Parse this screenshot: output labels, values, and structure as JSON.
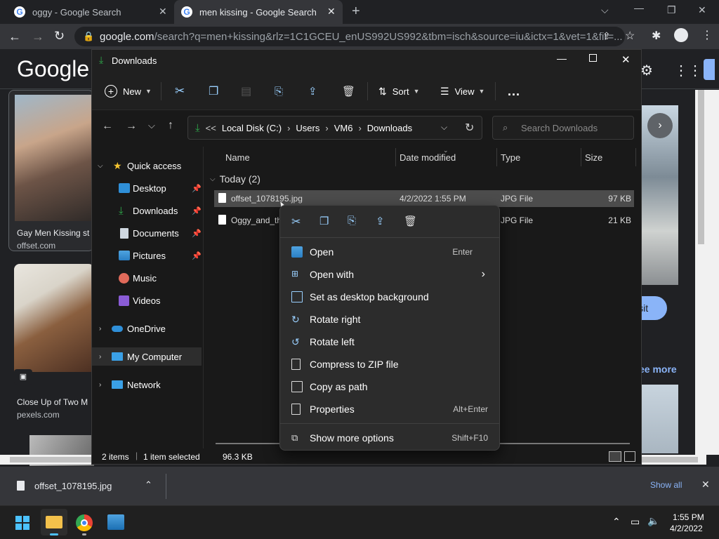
{
  "browser": {
    "tabs": [
      {
        "title": "oggy - Google Search",
        "active": false
      },
      {
        "title": "men kissing - Google Search",
        "active": true
      }
    ],
    "url_host": "google.com",
    "url_rest": "/search?q=men+kissing&rlz=1C1GCEU_enUS992US992&tbm=isch&source=iu&ictx=1&vet=1&fir=...",
    "logo": "Google",
    "results": [
      {
        "title": "Gay Men Kissing st",
        "source": "offset.com"
      },
      {
        "title": "Close Up of Two M",
        "source": "pexels.com"
      }
    ],
    "visit_label": "isit",
    "see_more_label": "ee more"
  },
  "explorer": {
    "title": "Downloads",
    "toolbar": {
      "new": "New",
      "sort": "Sort",
      "view": "View",
      "more": "..."
    },
    "path": [
      "Local Disk (C:)",
      "Users",
      "VM6",
      "Downloads"
    ],
    "path_prefix": "<<",
    "search_placeholder": "Search Downloads",
    "sidebar": {
      "quick_access": "Quick access",
      "items": [
        "Desktop",
        "Downloads",
        "Documents",
        "Pictures",
        "Music",
        "Videos"
      ],
      "onedrive": "OneDrive",
      "my_computer": "My Computer",
      "network": "Network"
    },
    "columns": {
      "name": "Name",
      "date": "Date modified",
      "type": "Type",
      "size": "Size"
    },
    "group_label": "Today (2)",
    "files": [
      {
        "name": "offset_1078195.jpg",
        "date": "4/2/2022 1:55 PM",
        "type": "JPG File",
        "size": "97 KB"
      },
      {
        "name": "Oggy_and_th",
        "date": "",
        "type": "JPG File",
        "size": "21 KB"
      }
    ],
    "status": {
      "items": "2 items",
      "selected": "1 item selected",
      "size": "96.3 KB"
    }
  },
  "context_menu": {
    "items": [
      {
        "label": "Open",
        "shortcut": "Enter"
      },
      {
        "label": "Open with",
        "shortcut": ""
      },
      {
        "label": "Set as desktop background",
        "shortcut": ""
      },
      {
        "label": "Rotate right",
        "shortcut": ""
      },
      {
        "label": "Rotate left",
        "shortcut": ""
      },
      {
        "label": "Compress to ZIP file",
        "shortcut": ""
      },
      {
        "label": "Copy as path",
        "shortcut": ""
      },
      {
        "label": "Properties",
        "shortcut": "Alt+Enter"
      },
      {
        "label": "Show more options",
        "shortcut": "Shift+F10"
      }
    ]
  },
  "download_bar": {
    "file": "offset_1078195.jpg",
    "show_all": "Show all"
  },
  "taskbar": {
    "time": "1:55 PM",
    "date": "4/2/2022"
  },
  "colors": {
    "accent_blue": "#8ab4f8",
    "explorer_bg": "#191919",
    "menu_bg": "#2c2c2c",
    "selection": "#4c4c4c"
  }
}
